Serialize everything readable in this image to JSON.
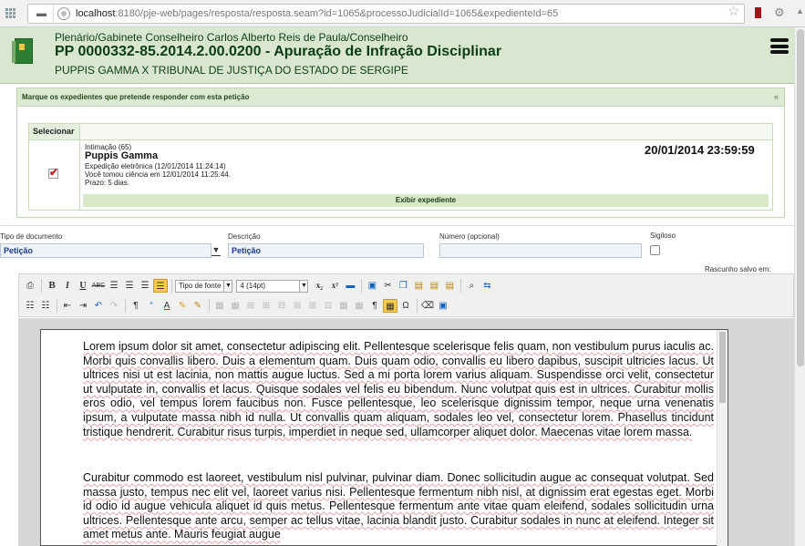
{
  "browser": {
    "url_host": "localhost",
    "url_rest": ":8180/pje-web/pages/resposta/resposta.seam?id=1065&processoJudicialId=1065&expedienteId=65",
    "icons": [
      "apps-icon",
      "page-icon",
      "site-info-icon",
      "star-icon",
      "extension-icon",
      "settings-icon"
    ]
  },
  "header": {
    "line1": "Plenário/Gabinete Conselheiro Carlos Alberto Reis de Paula/Conselheiro",
    "line2": "PP 0000332-85.2014.2.00.0200 - Apuração de Infração Disciplinar",
    "line3": "PUPPIS GAMMA X TRIBUNAL DE JUSTIÇA DO ESTADO DE SERGIPE"
  },
  "panel": {
    "title": "Marque os expedientes que pretende responder com esta petição",
    "collapse": "«",
    "column_header": "Selecionar",
    "expediente": {
      "tipo": "Intimação (65)",
      "parte": "Puppis Gamma",
      "expedicao": "Expedição eletrônica (12/01/2014 11:24:14)",
      "ciencia": "Você tomou ciência em 12/01/2014 11:25:44.",
      "prazo": "Prazo: 5 dias.",
      "data": "20/01/2014 23:59:59",
      "selected": true,
      "exibir": "Exibir expediente"
    }
  },
  "form": {
    "tipo_label": "Tipo de documento",
    "tipo_value": "Petição",
    "descricao_label": "Descrição",
    "descricao_value": "Petição",
    "numero_label": "Número (opcional)",
    "numero_value": "",
    "sigiloso_label": "Sigiloso",
    "rascunho": "Rascunho salvo em:"
  },
  "toolbar": {
    "font_family": "Tipo de fonte",
    "font_size": "4 (14pt)"
  },
  "editor": {
    "paragraph1": "Lorem ipsum dolor sit amet, consectetur adipiscing elit. Pellentesque scelerisque felis quam, non vestibulum purus iaculis ac. Morbi quis convallis libero. Duis a elementum quam. Duis quam odio, convallis eu libero dapibus, suscipit ultricies lacus. Ut ultrices nisi ut est lacinia, non mattis augue luctus. Sed a mi porta lorem varius aliquam. Suspendisse orci velit, consectetur ut vulputate in, convallis et lacus. Quisque sodales vel felis eu bibendum. Nunc volutpat quis est in ultrices. Curabitur mollis eros odio, vel tempus lorem faucibus non. Fusce pellentesque, leo scelerisque dignissim tempor, neque urna venenatis ipsum, a vulputate massa nibh id nulla. Ut convallis quam aliquam, sodales leo vel, consectetur lorem. Phasellus tincidunt tristique hendrerit. Curabitur risus turpis, imperdiet in neque sed, ullamcorper aliquet dolor. Maecenas vitae lorem massa.",
    "paragraph2": "Curabitur commodo est laoreet, vestibulum nisl pulvinar, pulvinar diam. Donec sollicitudin augue ac consequat volutpat. Sed massa justo, tempus nec elit vel, laoreet varius nisi. Pellentesque fermentum nibh nisl, at dignissim erat egestas eget. Morbi id odio id augue vehicula aliquet id quis metus. Pellentesque fermentum ante vitae quam eleifend, sodales sollicitudin urna ultrices. Pellentesque ante arcu, semper ac tellus vitae, lacinia blandit justo. Curabitur sodales in nunc at eleifend. Integer sit amet metus ante. Mauris feugiat augue"
  },
  "colors": {
    "header_bg": "#d9e7d0",
    "panel_head_bg": "#dce9d3",
    "exibir_bg": "#d9e9c8",
    "link_blue": "#1e3a8a"
  }
}
